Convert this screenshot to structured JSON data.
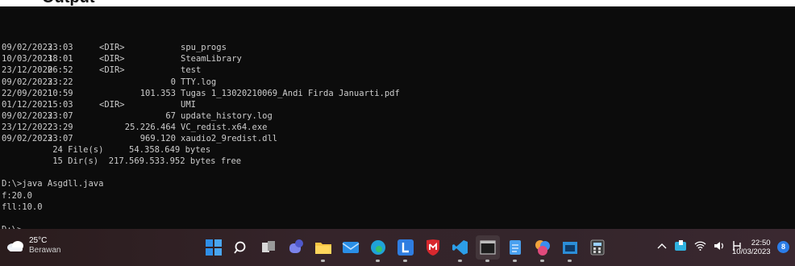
{
  "heading": "Output",
  "console": {
    "entries": [
      {
        "date": "09/02/2023",
        "time": "23:03",
        "dir": "<DIR>",
        "size": "",
        "name": "spu_progs"
      },
      {
        "date": "10/03/2023",
        "time": "18:01",
        "dir": "<DIR>",
        "size": "",
        "name": "SteamLibrary"
      },
      {
        "date": "23/12/2022",
        "time": "06:52",
        "dir": "<DIR>",
        "size": "",
        "name": "test"
      },
      {
        "date": "09/02/2023",
        "time": "23:22",
        "dir": "",
        "size": "0",
        "name": "TTY.log"
      },
      {
        "date": "22/09/2021",
        "time": "10:59",
        "dir": "",
        "size": "101.353",
        "name": "Tugas 1_13020210069_Andi Firda Januarti.pdf"
      },
      {
        "date": "01/12/2021",
        "time": "15:03",
        "dir": "<DIR>",
        "size": "",
        "name": "UMI"
      },
      {
        "date": "09/02/2023",
        "time": "23:07",
        "dir": "",
        "size": "67",
        "name": "update_history.log"
      },
      {
        "date": "23/12/2022",
        "time": "23:29",
        "dir": "",
        "size": "25.226.464",
        "name": "VC_redist.x64.exe"
      },
      {
        "date": "09/02/2023",
        "time": "23:07",
        "dir": "",
        "size": "969.120",
        "name": "xaudio2_9redist.dll"
      }
    ],
    "summary_files": {
      "count": "24 File(s)",
      "value": "54.358.649 bytes"
    },
    "summary_dirs": {
      "count": "15 Dir(s)",
      "value": "217.569.533.952 bytes free"
    },
    "command": "D:\\>java Asgdll.java",
    "output_1": "f:20.0",
    "output_2": "fll:10.0",
    "prompt": "D:\\>"
  },
  "taskbar": {
    "weather_temp": "25°C",
    "weather_cond": "Berawan",
    "time": "22:50",
    "date": "10/03/2023",
    "notification_count": "8",
    "apps": [
      "start-button",
      "search-button",
      "task-view-button",
      "chat-button",
      "file-explorer-button",
      "mail-button",
      "edge-button",
      "app-l-button",
      "mcafee-button",
      "vscode-button",
      "terminal-button",
      "notepad-button",
      "color-app-button",
      "cmd-button",
      "calculator-button"
    ]
  }
}
